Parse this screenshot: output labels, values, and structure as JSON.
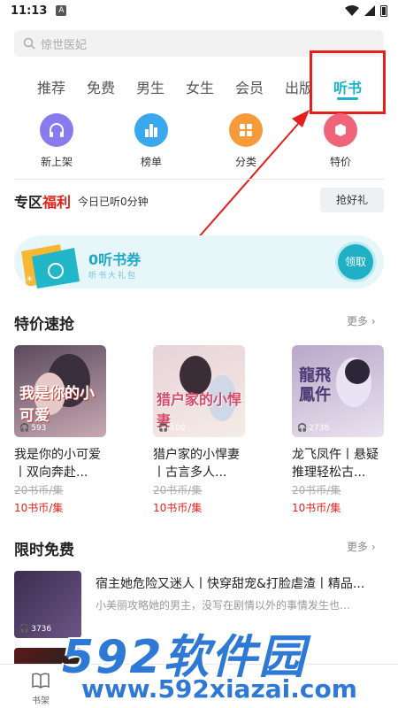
{
  "status": {
    "time": "11:13",
    "a_label": "A"
  },
  "search": {
    "placeholder": "惊世医妃"
  },
  "tabs": [
    {
      "label": "推荐"
    },
    {
      "label": "免费"
    },
    {
      "label": "男生"
    },
    {
      "label": "女生"
    },
    {
      "label": "会员"
    },
    {
      "label": "出版"
    },
    {
      "label": "听书"
    }
  ],
  "active_tab": "听书",
  "quick_links": [
    {
      "label": "新上架",
      "icon": "headphones-icon",
      "color": "#8a7af0"
    },
    {
      "label": "榜单",
      "icon": "chart-icon",
      "color": "#39a8ec"
    },
    {
      "label": "分类",
      "icon": "grid-icon",
      "color": "#f79a3a"
    },
    {
      "label": "特价",
      "icon": "tag-icon",
      "color": "#f0647a"
    }
  ],
  "zone": {
    "title_prefix": "专区",
    "title_highlight": "福利",
    "subtitle": "今日已听0分钟",
    "button": "抢好礼"
  },
  "coupon": {
    "title": "0听书券",
    "subtitle": "听书大礼包",
    "button": "领取"
  },
  "special": {
    "title": "特价速抢",
    "more": "更多",
    "books": [
      {
        "title": "我是你的小可爱丨双向奔赴...",
        "cover_text": "我是你的小可爱",
        "count": "593",
        "old_price": "20书币/集",
        "price": "10书币/集",
        "color_a": "#5a4a5e",
        "color_b": "#c9a9b2"
      },
      {
        "title": "猎户家的小悍妻丨古言多人...",
        "cover_text": "猎户家的小悍妻",
        "count": "100",
        "old_price": "20书币/集",
        "price": "10书币/集",
        "color_a": "#e8d3d8",
        "color_b": "#f5ece6"
      },
      {
        "title": "龙飞凤仵丨悬疑推理轻松古...",
        "cover_text": "龍飛鳳仵",
        "count": "2738",
        "old_price": "20书币/集",
        "price": "10书币/集",
        "color_a": "#b9a8c9",
        "color_b": "#e9e2ef"
      }
    ]
  },
  "free": {
    "title": "限时免费",
    "more": "更多",
    "item": {
      "title": "宿主她危险又迷人丨快穿甜宠&打脸虐渣丨精品...",
      "desc": "小美丽攻略她的男主，没写在剧情以外的事情发生也…",
      "count": "3736"
    }
  },
  "bottom_nav": {
    "shelf_label": "书架"
  },
  "watermark": {
    "logo": "592软件园",
    "url": "www.592xiazai.com"
  }
}
